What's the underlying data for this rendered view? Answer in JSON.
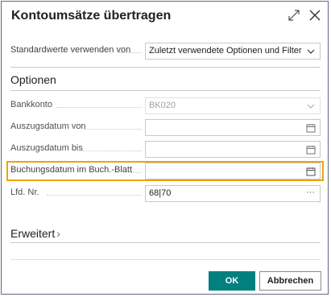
{
  "dialog": {
    "title": "Kontoumsätze übertragen"
  },
  "defaults": {
    "label": "Standardwerte verwenden von",
    "value": "Zuletzt verwendete Optionen und Filter"
  },
  "options": {
    "heading": "Optionen",
    "fields": [
      {
        "label": "Bankkonto",
        "value": "BK020",
        "trailing_icon": "chevron-down-icon",
        "disabled": true
      },
      {
        "label": "Auszugsdatum von",
        "value": "",
        "trailing_icon": "calendar-icon",
        "disabled": false
      },
      {
        "label": "Auszugsdatum bis",
        "value": "",
        "trailing_icon": "calendar-icon",
        "disabled": false
      },
      {
        "label": "Buchungsdatum im Buch.-Blatt",
        "value": "",
        "trailing_icon": "calendar-icon",
        "disabled": false,
        "highlighted": true
      },
      {
        "label": "Lfd. Nr.",
        "value": "68|70",
        "trailing_icon": "ellipsis-icon",
        "disabled": false
      }
    ]
  },
  "advanced": {
    "heading": "Erweitert",
    "chevron": "›"
  },
  "footer": {
    "ok_label": "OK",
    "cancel_label": "Abbrechen"
  },
  "colors": {
    "accent": "#00807e",
    "highlight": "#f0a30a"
  }
}
